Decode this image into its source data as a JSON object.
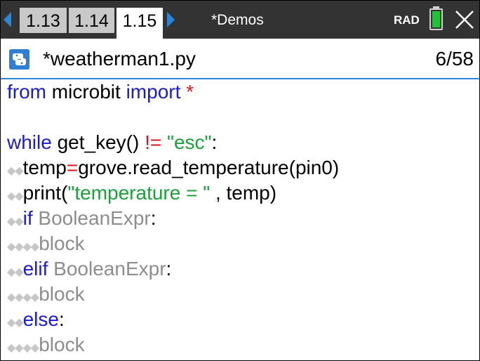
{
  "topbar": {
    "tabs": [
      "1.13",
      "1.14",
      "1.15"
    ],
    "active_tab": "1.15",
    "document_title": "*Demos",
    "angle_mode": "RAD"
  },
  "editor": {
    "filename": "*weatherman1.py",
    "position": "6/58"
  },
  "code": {
    "indent_glyph": "◆",
    "l1": {
      "from": "from",
      "module": " microbit ",
      "import": "import",
      "star": " *"
    },
    "l3": {
      "while": "while",
      "call": " get_key() ",
      "neq": "!=",
      "sp": " ",
      "esc": "\"esc\"",
      "colon": ":"
    },
    "l4": {
      "ind": "◆◆",
      "var": "temp",
      "eq": "=",
      "rest": "grove.read_temperature(pin0)"
    },
    "l5": {
      "ind": "◆◆",
      "print": "print(",
      "str": "\"temperature = \"",
      "rest": " , temp)"
    },
    "l6": {
      "ind": "◆◆",
      "kw": "if",
      "ph": " BooleanExpr",
      "colon": ":"
    },
    "l7": {
      "ind": "◆◆◆◆",
      "ph": "block"
    },
    "l8": {
      "ind": "◆◆",
      "kw": "elif",
      "ph": " BooleanExpr",
      "colon": ":"
    },
    "l9": {
      "ind": "◆◆◆◆",
      "ph": "block"
    },
    "l10": {
      "ind": "◆◆",
      "kw": "else",
      "colon": ":"
    },
    "l11": {
      "ind": "◆◆◆◆",
      "ph": "block"
    }
  }
}
